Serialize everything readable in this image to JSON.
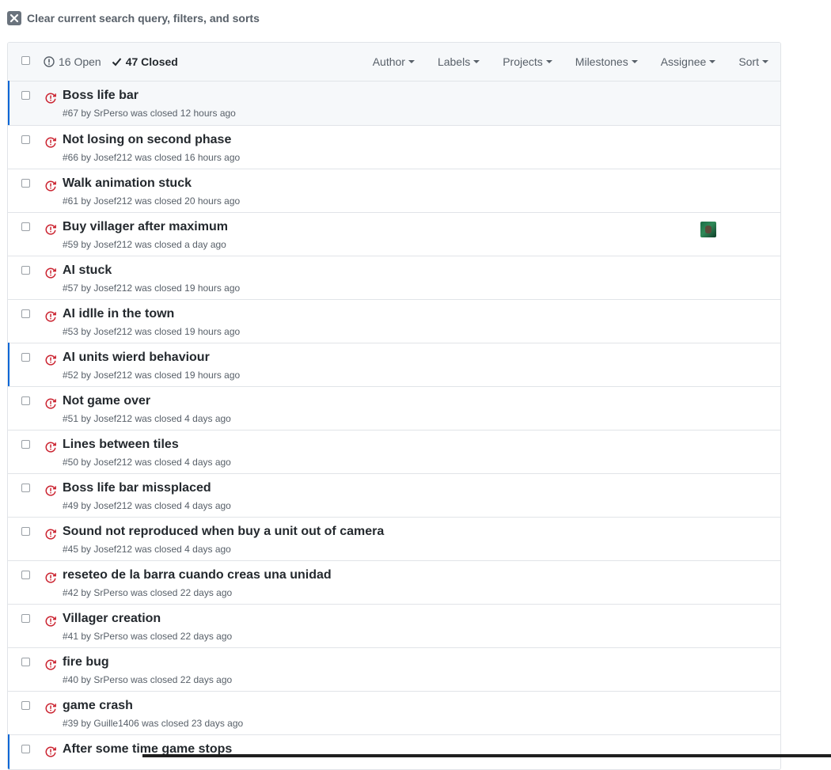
{
  "clear_filters": {
    "label": "Clear current search query, filters, and sorts"
  },
  "header": {
    "open_label": "16 Open",
    "closed_label": "47 Closed",
    "filters": [
      "Author",
      "Labels",
      "Projects",
      "Milestones",
      "Assignee",
      "Sort"
    ]
  },
  "colors": {
    "closed_icon": "#cb2431",
    "accent_marker": "#0366d6"
  },
  "issues": [
    {
      "title": "Boss life bar",
      "number": "#67",
      "by": "by",
      "author": "SrPerso",
      "status": "was closed 12 hours ago"
    },
    {
      "title": "Not losing on second phase",
      "number": "#66",
      "by": "by",
      "author": "Josef212",
      "status": "was closed 16 hours ago"
    },
    {
      "title": "Walk animation stuck",
      "number": "#61",
      "by": "by",
      "author": "Josef212",
      "status": "was closed 20 hours ago"
    },
    {
      "title": "Buy villager after maximum",
      "number": "#59",
      "by": "by",
      "author": "Josef212",
      "status": "was closed a day ago"
    },
    {
      "title": "AI stuck",
      "number": "#57",
      "by": "by",
      "author": "Josef212",
      "status": "was closed 19 hours ago"
    },
    {
      "title": "AI idlle in the town",
      "number": "#53",
      "by": "by",
      "author": "Josef212",
      "status": "was closed 19 hours ago"
    },
    {
      "title": "AI units wierd behaviour",
      "number": "#52",
      "by": "by",
      "author": "Josef212",
      "status": "was closed 19 hours ago"
    },
    {
      "title": "Not game over",
      "number": "#51",
      "by": "by",
      "author": "Josef212",
      "status": "was closed 4 days ago"
    },
    {
      "title": "Lines between tiles",
      "number": "#50",
      "by": "by",
      "author": "Josef212",
      "status": "was closed 4 days ago"
    },
    {
      "title": "Boss life bar missplaced",
      "number": "#49",
      "by": "by",
      "author": "Josef212",
      "status": "was closed 4 days ago"
    },
    {
      "title": "Sound not reproduced when buy a unit out of camera",
      "number": "#45",
      "by": "by",
      "author": "Josef212",
      "status": "was closed 4 days ago"
    },
    {
      "title": "reseteo de la barra cuando creas una unidad",
      "number": "#42",
      "by": "by",
      "author": "SrPerso",
      "status": "was closed 22 days ago"
    },
    {
      "title": "Villager creation",
      "number": "#41",
      "by": "by",
      "author": "SrPerso",
      "status": "was closed 22 days ago"
    },
    {
      "title": "fire bug",
      "number": "#40",
      "by": "by",
      "author": "SrPerso",
      "status": "was closed 22 days ago"
    },
    {
      "title": "game crash",
      "number": "#39",
      "by": "by",
      "author": "Guille1406",
      "status": "was closed 23 days ago"
    },
    {
      "title": "After some time game stops",
      "number": "",
      "by": "",
      "author": "",
      "status": ""
    }
  ]
}
